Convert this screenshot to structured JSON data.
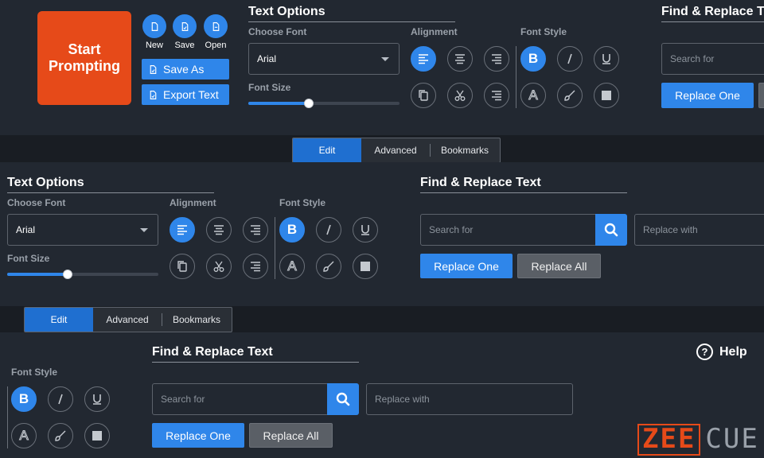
{
  "ribbon": {
    "start_button": "Start Prompting",
    "file_buttons": [
      {
        "label": "New",
        "icon": "new-file-icon"
      },
      {
        "label": "Save",
        "icon": "save-file-icon"
      },
      {
        "label": "Open",
        "icon": "open-file-icon"
      }
    ],
    "save_as": "Save As",
    "export_text": "Export Text",
    "text_options": {
      "title": "Text Options",
      "choose_font_label": "Choose Font",
      "font_value": "Arial",
      "font_size_label": "Font Size",
      "font_size_level": 0.4,
      "alignment_label": "Alignment",
      "font_style_label": "Font Style"
    },
    "find_replace": {
      "title": "Find & Replace T",
      "search_placeholder": "Search for",
      "replace_one": "Replace One"
    }
  },
  "tabs_bar_1": {
    "tabs": [
      "Edit",
      "Advanced",
      "Bookmarks"
    ],
    "active": "Edit"
  },
  "section2": {
    "text_options": {
      "title": "Text Options",
      "choose_font_label": "Choose Font",
      "font_value": "Arial",
      "font_size_label": "Font Size",
      "font_size_level": 0.4,
      "alignment_label": "Alignment",
      "font_style_label": "Font Style"
    },
    "find_replace": {
      "title": "Find & Replace Text",
      "search_placeholder": "Search for",
      "replace_placeholder": "Replace with",
      "replace_one": "Replace One",
      "replace_all": "Replace All"
    }
  },
  "tabs_bar_2": {
    "tabs": [
      "Edit",
      "Advanced",
      "Bookmarks"
    ],
    "active": "Edit"
  },
  "section3": {
    "font_style_label": "Font Style",
    "find_replace": {
      "title": "Find & Replace Text",
      "search_placeholder": "Search for",
      "replace_placeholder": "Replace with",
      "replace_one": "Replace One",
      "replace_all": "Replace All"
    },
    "help": "Help"
  },
  "logo": {
    "left": "ZEE",
    "right": "CUE"
  },
  "colors": {
    "accent": "#2f86ea",
    "start_button": "#e64a19",
    "background": "#222831"
  }
}
